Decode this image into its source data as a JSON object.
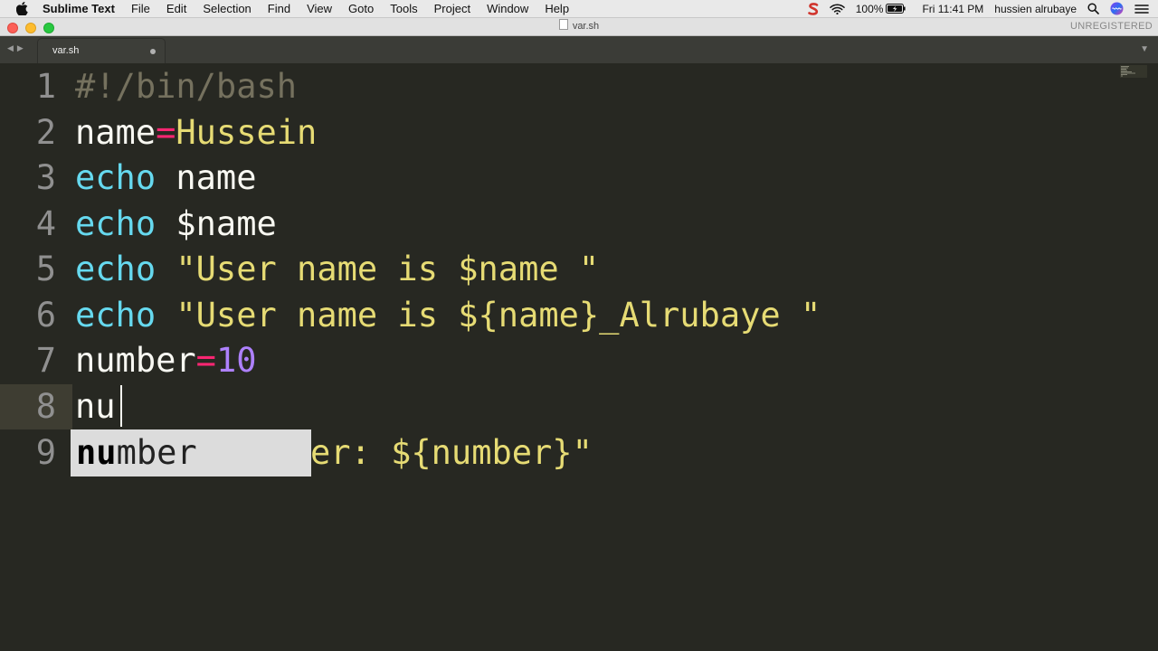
{
  "menubar": {
    "app_name": "Sublime Text",
    "items": [
      "File",
      "Edit",
      "Selection",
      "Find",
      "View",
      "Goto",
      "Tools",
      "Project",
      "Window",
      "Help"
    ],
    "battery": "100%",
    "clock": "Fri 11:41 PM",
    "user": "hussien alrubaye",
    "icons": [
      "apple-icon",
      "sublime-s-icon",
      "wifi-icon",
      "battery-icon",
      "spotlight-search-icon",
      "siri-icon",
      "menu-list-icon"
    ]
  },
  "window": {
    "title": "var.sh",
    "license_status": "UNREGISTERED"
  },
  "tabs": [
    {
      "label": "var.sh",
      "modified": true
    }
  ],
  "editor": {
    "line_numbers": [
      "1",
      "2",
      "3",
      "4",
      "5",
      "6",
      "7",
      "8",
      "9"
    ],
    "current_line": "8",
    "lines": {
      "l1": "#!/bin/bash",
      "l2_var": "name",
      "l2_op": "=",
      "l2_val": "Hussein",
      "l3_kw": "echo",
      "l3_arg": " name",
      "l4_kw": "echo",
      "l4_arg": " $name",
      "l5_kw": "echo",
      "l5_str": " \"User name is $name \"",
      "l6_kw": "echo",
      "l6_str": " \"User name is ${name}_Alrubaye \"",
      "l7_var": "number",
      "l7_op": "=",
      "l7_val": "10",
      "l8": "nu",
      "l9_visible": "er: ${number}\""
    },
    "autocomplete": {
      "match": "nu",
      "rest": "mber"
    },
    "colors": {
      "background": "#272822",
      "comment": "#75715e",
      "operator": "#f92672",
      "string": "#e6db74",
      "keyword": "#66d9ef",
      "number": "#ae81ff",
      "text": "#f8f8f2"
    }
  }
}
